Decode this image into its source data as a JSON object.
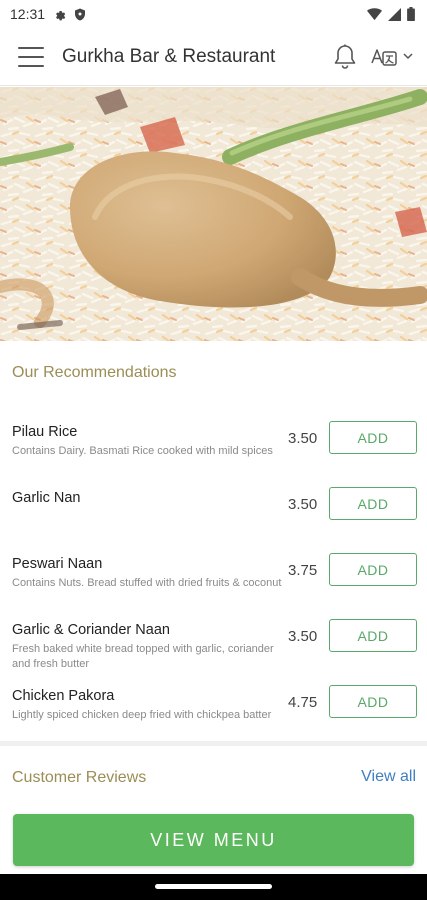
{
  "status_bar": {
    "time": "12:31"
  },
  "app_bar": {
    "title": "Gurkha Bar & Restaurant"
  },
  "recommendations": {
    "title": "Our Recommendations",
    "add_label": "ADD",
    "items": [
      {
        "name": "Pilau Rice",
        "description": "Contains Dairy. Basmati Rice cooked with mild spices",
        "price": "3.50"
      },
      {
        "name": "Garlic Nan",
        "description": "",
        "price": "3.50"
      },
      {
        "name": "Peswari Naan",
        "description": "Contains Nuts. Bread stuffed with dried fruits & coconut",
        "price": "3.75"
      },
      {
        "name": "Garlic & Coriander Naan",
        "description": "Fresh baked white bread topped with garlic, coriander and fresh butter",
        "price": "3.50"
      },
      {
        "name": "Chicken Pakora",
        "description": "Lightly spiced chicken deep fried with chickpea batter",
        "price": "4.75"
      }
    ]
  },
  "reviews": {
    "title": "Customer Reviews",
    "view_all_label": "View all"
  },
  "footer": {
    "view_menu_label": "VIEW MENU"
  },
  "colors": {
    "accent_green": "#5cb85c",
    "section_title": "#9b8d55",
    "link_blue": "#3f7fbf"
  }
}
